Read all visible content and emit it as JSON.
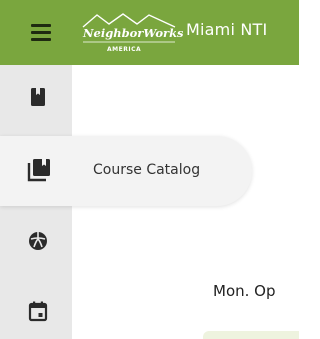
{
  "header": {
    "logo_wordmark": "NeighborWorks",
    "logo_sub": "AMERICA",
    "site_name": "Miami NTI"
  },
  "sidebar": {
    "items": [
      {
        "icon": "book-icon"
      },
      {
        "icon": "course-catalog-icon",
        "label": "Course Catalog"
      },
      {
        "icon": "sports-ball-icon"
      },
      {
        "icon": "calendar-icon"
      }
    ]
  },
  "main": {
    "event_title": "Mon. Op"
  },
  "colors": {
    "header_bg": "#7aa63e",
    "sidebar_bg": "#e8e8e8"
  }
}
